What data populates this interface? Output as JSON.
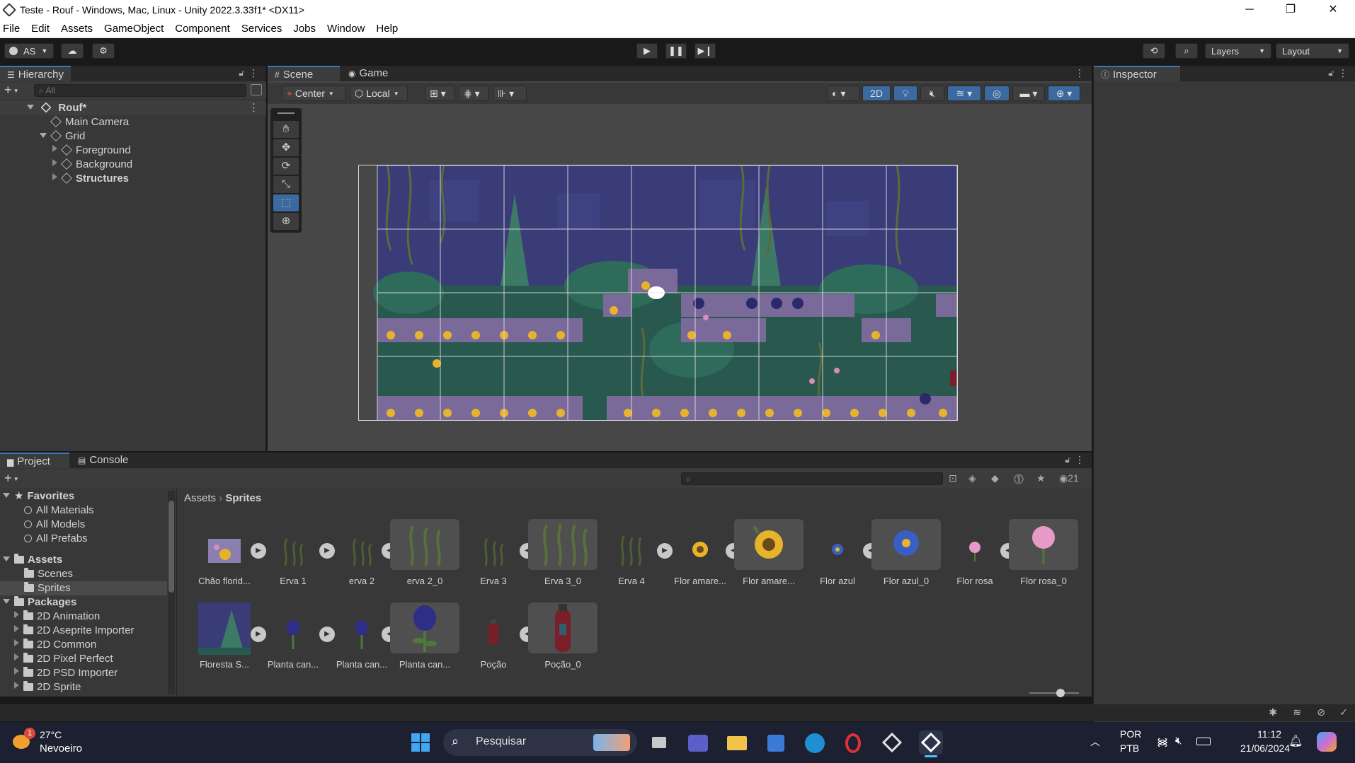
{
  "window": {
    "title": "Teste - Rouf - Windows, Mac, Linux - Unity 2022.3.33f1* <DX11>",
    "controls": [
      "─",
      "❐",
      "✕"
    ]
  },
  "menu": [
    "File",
    "Edit",
    "Assets",
    "GameObject",
    "Component",
    "Services",
    "Jobs",
    "Window",
    "Help"
  ],
  "toolbar": {
    "account_label": "AS",
    "layers_label": "Layers",
    "layout_label": "Layout"
  },
  "hierarchy": {
    "tab_label": "Hierarchy",
    "search_placeholder": "All",
    "scene_name": "Rouf*",
    "items": [
      {
        "label": "Main Camera"
      },
      {
        "label": "Grid"
      },
      {
        "label": "Foreground"
      },
      {
        "label": "Background"
      },
      {
        "label": "Structures"
      }
    ]
  },
  "scene": {
    "tabs": [
      "Scene",
      "Game"
    ],
    "pivot_label": "Center",
    "space_label": "Local",
    "mode_2d_label": "2D"
  },
  "inspector": {
    "tab_label": "Inspector"
  },
  "project": {
    "tabs": [
      "Project",
      "Console"
    ],
    "hidden_count": "21",
    "breadcrumb": [
      "Assets",
      "Sprites"
    ],
    "tree": {
      "favorites_label": "Favorites",
      "favorites": [
        "All Materials",
        "All Models",
        "All Prefabs"
      ],
      "assets_label": "Assets",
      "assets": [
        "Scenes",
        "Sprites"
      ],
      "packages_label": "Packages",
      "packages": [
        "2D Animation",
        "2D Aseprite Importer",
        "2D Common",
        "2D Pixel Perfect",
        "2D PSD Importer",
        "2D Sprite"
      ]
    },
    "assets": [
      {
        "label": "Chão florid...",
        "icon": "ground-tile-icon"
      },
      {
        "label": "Erva 1",
        "icon": "grass-icon"
      },
      {
        "label": "erva 2",
        "icon": "grass-icon"
      },
      {
        "label": "erva 2_0",
        "icon": "grass-icon"
      },
      {
        "label": "Erva 3",
        "icon": "grass-icon"
      },
      {
        "label": "Erva 3_0",
        "icon": "grass-icon"
      },
      {
        "label": "Erva 4",
        "icon": "grass-icon"
      },
      {
        "label": "Flor amare...",
        "icon": "sunflower-icon"
      },
      {
        "label": "Flor amare...",
        "icon": "sunflower-icon"
      },
      {
        "label": "Flor azul",
        "icon": "blue-flower-icon"
      },
      {
        "label": "Flor azul_0",
        "icon": "blue-flower-icon"
      },
      {
        "label": "Flor rosa",
        "icon": "pink-flower-icon"
      },
      {
        "label": "Flor rosa_0",
        "icon": "pink-flower-icon"
      },
      {
        "label": "Floresta S...",
        "icon": "forest-icon"
      },
      {
        "label": "Planta can...",
        "icon": "plant-icon"
      },
      {
        "label": "Planta can...",
        "icon": "plant-icon"
      },
      {
        "label": "Planta can...",
        "icon": "plant-icon"
      },
      {
        "label": "Poção",
        "icon": "potion-icon"
      },
      {
        "label": "Poção_0",
        "icon": "potion-icon"
      }
    ]
  },
  "taskbar": {
    "weather_temp": "27°C",
    "weather_desc": "Nevoeiro",
    "notification_count": "1",
    "search_label": "Pesquisar",
    "lang_top": "POR",
    "lang_bottom": "PTB",
    "time": "11:12",
    "date": "21/06/2024"
  },
  "colors": {
    "editor_bg": "#383838",
    "dark_bg": "#191919",
    "accent": "#3a79bb",
    "sky": "#3a3c78",
    "foliage": "#2f6b5a"
  }
}
